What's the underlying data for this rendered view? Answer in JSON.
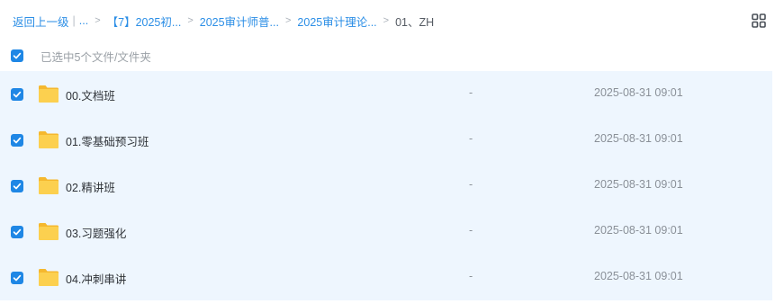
{
  "breadcrumb": {
    "back": "返回上一级",
    "ellipsis": "...",
    "items": [
      "【7】2025初...",
      "2025审计师普...",
      "2025审计理论..."
    ],
    "current": "01、ZH"
  },
  "selection": {
    "text": "已选中5个文件/文件夹"
  },
  "files": [
    {
      "name": "00.文档班",
      "size": "-",
      "date": "2025-08-31 09:01"
    },
    {
      "name": "01.零基础预习班",
      "size": "-",
      "date": "2025-08-31 09:01"
    },
    {
      "name": "02.精讲班",
      "size": "-",
      "date": "2025-08-31 09:01"
    },
    {
      "name": "03.习题强化",
      "size": "-",
      "date": "2025-08-31 09:01"
    },
    {
      "name": "04.冲刺串讲",
      "size": "-",
      "date": "2025-08-31 09:01"
    }
  ],
  "icons": {
    "view_toggle": "grid-view-icon",
    "folder": "folder-icon",
    "check": "check-icon"
  },
  "colors": {
    "accent": "#1f87e5",
    "row_bg": "#eef6fe",
    "folder": "#f9c940"
  }
}
